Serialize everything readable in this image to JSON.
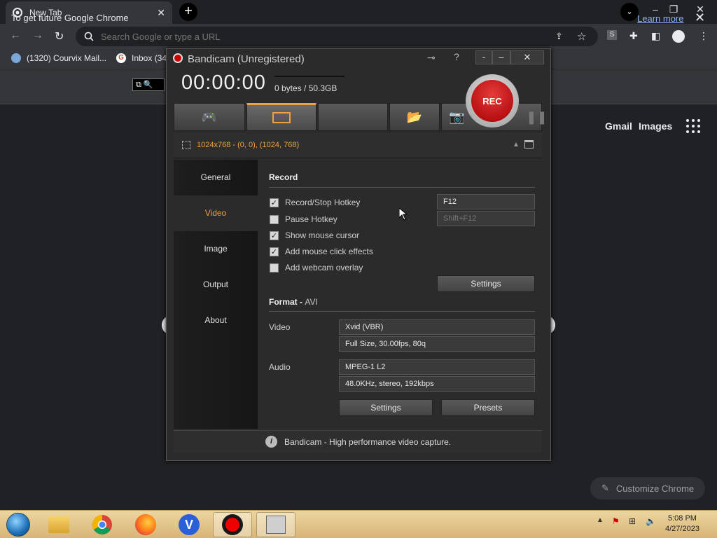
{
  "chrome": {
    "tab_title": "New Tab",
    "omnibox_placeholder": "Search Google or type a URL",
    "bookmarks": [
      "(1320) Courvix Mail...",
      "Inbox (34"
    ],
    "infobar_text": "To get future Google Chrome",
    "learn_more": "Learn more",
    "ntp_links": [
      "Gmail",
      "Images"
    ],
    "customize": "Customize Chrome"
  },
  "bandicam": {
    "title": "Bandicam (Unregistered)",
    "timer": "00:00:00",
    "size": "0 bytes / 50.3GB",
    "rec_label": "REC",
    "region": "1024x768 - (0, 0), (1024, 768)",
    "sidebar": [
      {
        "label": "General",
        "active": false
      },
      {
        "label": "Video",
        "active": true
      },
      {
        "label": "Image",
        "active": false
      },
      {
        "label": "Output",
        "active": false
      },
      {
        "label": "About",
        "active": false
      }
    ],
    "record": {
      "heading": "Record",
      "checks": [
        {
          "label": "Record/Stop Hotkey",
          "checked": true
        },
        {
          "label": "Pause Hotkey",
          "checked": false
        },
        {
          "label": "Show mouse cursor",
          "checked": true
        },
        {
          "label": "Add mouse click effects",
          "checked": true
        },
        {
          "label": "Add webcam overlay",
          "checked": false
        }
      ],
      "hotkey": "F12",
      "pause_hotkey": "Shift+F12",
      "settings": "Settings"
    },
    "format": {
      "heading": "Format",
      "container": "AVI",
      "video_label": "Video",
      "video_codec": "Xvid (VBR)",
      "video_detail": "Full Size, 30.00fps, 80q",
      "audio_label": "Audio",
      "audio_codec": "MPEG-1 L2",
      "audio_detail": "48.0KHz, stereo, 192kbps",
      "settings": "Settings",
      "presets": "Presets"
    },
    "status": "Bandicam - High performance video capture."
  },
  "taskbar": {
    "time": "5:08 PM",
    "date": "4/27/2023"
  }
}
